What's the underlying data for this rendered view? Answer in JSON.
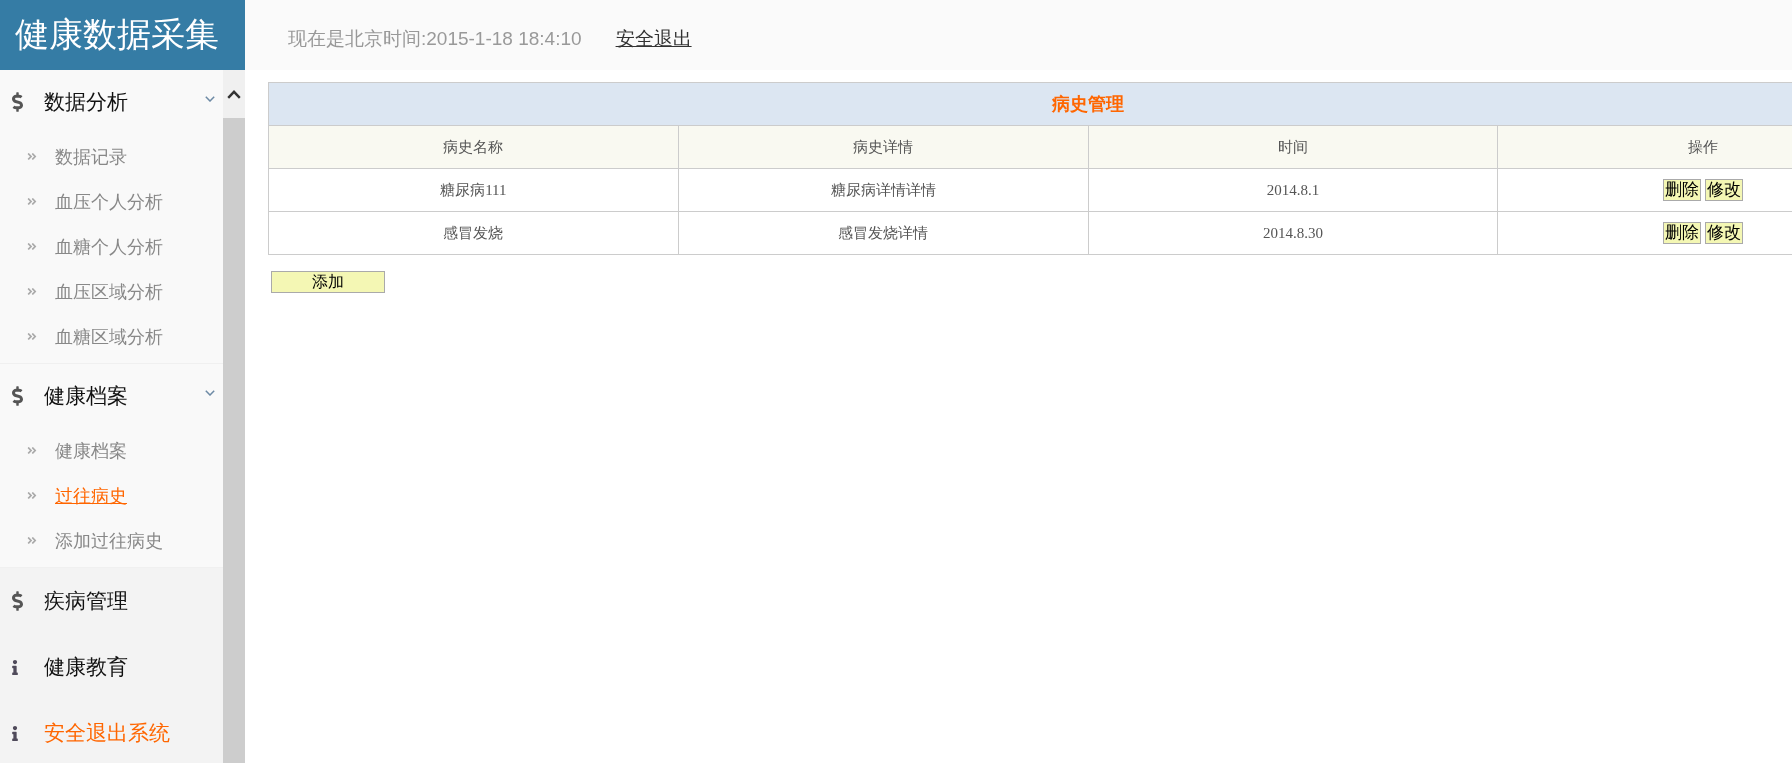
{
  "header": {
    "title": "健康数据采集",
    "clock": "现在是北京时间:2015-1-18 18:4:10",
    "logout_link": "安全退出"
  },
  "sidebar": {
    "groups": [
      {
        "label": "数据分析",
        "kind": "module",
        "expanded": true,
        "children": [
          {
            "label": "数据记录",
            "selected": false
          },
          {
            "label": "血压个人分析",
            "selected": false
          },
          {
            "label": "血糖个人分析",
            "selected": false
          },
          {
            "label": "血压区域分析",
            "selected": false
          },
          {
            "label": "血糖区域分析",
            "selected": false
          }
        ]
      },
      {
        "label": "健康档案",
        "kind": "module",
        "expanded": true,
        "children": [
          {
            "label": "健康档案",
            "selected": false
          },
          {
            "label": "过往病史",
            "selected": true
          },
          {
            "label": "添加过往病史",
            "selected": false
          }
        ]
      },
      {
        "label": "疾病管理",
        "kind": "module",
        "expanded": false
      },
      {
        "label": "健康教育",
        "kind": "page",
        "expanded": false
      },
      {
        "label": "安全退出系统",
        "kind": "exit",
        "expanded": false
      }
    ]
  },
  "table": {
    "title": "病史管理",
    "columns": [
      "病史名称",
      "病史详情",
      "时间",
      "操作"
    ],
    "rows": [
      {
        "cells": [
          "糖尿病111",
          "糖尿病详情详情",
          "2014.8.1"
        ],
        "actions": [
          "删除",
          "修改"
        ]
      },
      {
        "cells": [
          "感冒发烧",
          "感冒发烧详情",
          "2014.8.30"
        ],
        "actions": [
          "删除",
          "修改"
        ]
      }
    ]
  },
  "add_button": "添加"
}
